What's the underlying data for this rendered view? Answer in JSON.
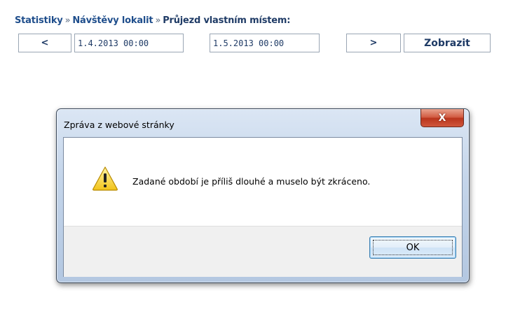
{
  "breadcrumb": {
    "items": [
      "Statistiky",
      "Návštěvy lokalit",
      "Průjezd vlastním místem:"
    ],
    "separator": "»"
  },
  "toolbar": {
    "prev_label": "<",
    "from_value": "1.4.2013 00:00",
    "to_value": "1.5.2013 00:00",
    "next_label": ">",
    "show_label": "Zobrazit"
  },
  "dialog": {
    "title": "Zpráva z webové stránky",
    "close_label": "X",
    "message": "Zadané období je příliš dlouhé a muselo být zkráceno.",
    "ok_label": "OK",
    "icon": "warning-icon"
  },
  "colors": {
    "link": "#1f4e8c",
    "text_dark": "#1f3b66",
    "dialog_frame": "#c4d5ea",
    "close_button": "#c7452c",
    "ok_border": "#3c7fb1"
  }
}
